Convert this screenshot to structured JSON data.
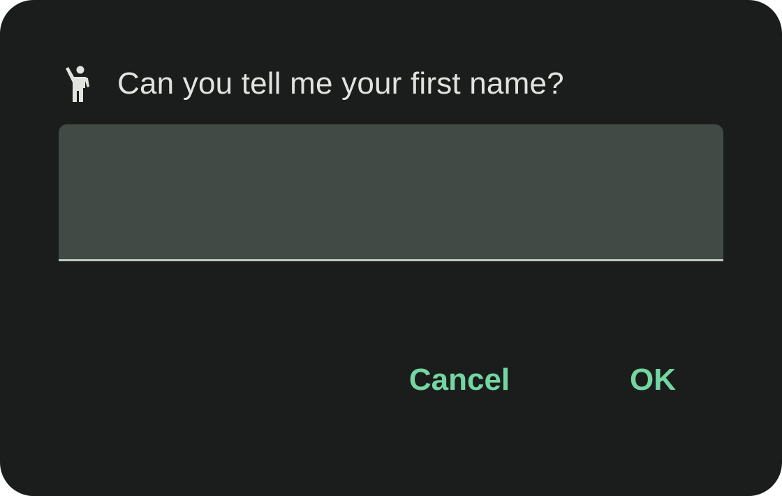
{
  "dialog": {
    "title_icon": "person-waving-icon",
    "title": "Can you tell me your first name?",
    "input": {
      "value": "",
      "placeholder": ""
    },
    "buttons": {
      "cancel_label": "Cancel",
      "ok_label": "OK"
    }
  },
  "colors": {
    "background": "#1b1d1c",
    "field": "#414a45",
    "accent": "#74d6a2",
    "text": "#e2e3de"
  }
}
